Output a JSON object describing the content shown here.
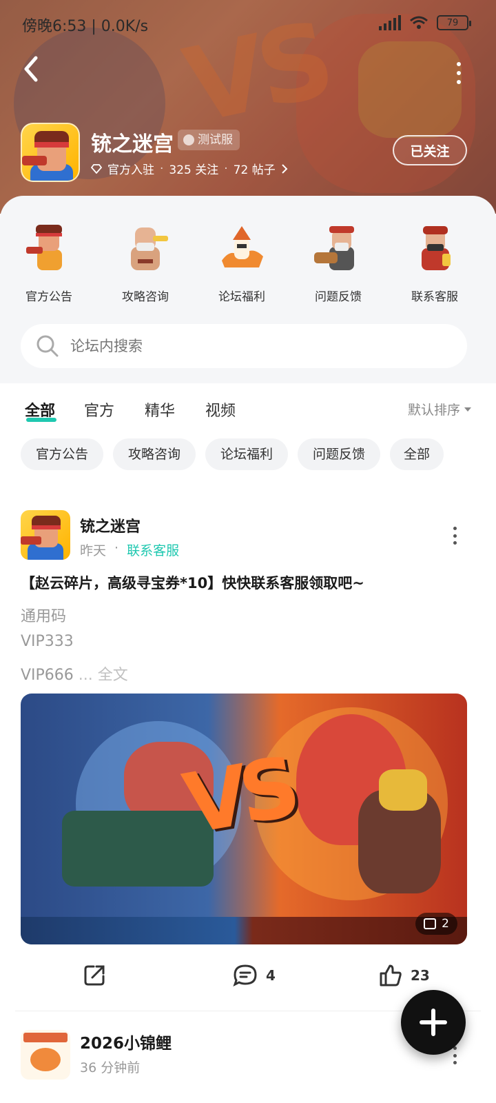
{
  "status_bar": {
    "time": "傍晚6:53 | 0.0K/s",
    "battery": "79"
  },
  "header": {
    "game_title": "铳之迷宫",
    "server_badge": "测试服",
    "official": "官方入驻",
    "followers": "325 关注",
    "posts": "72 帖子",
    "follow_button": "已关注"
  },
  "categories": [
    {
      "label": "官方公告",
      "icon": "announcement-character-icon"
    },
    {
      "label": "攻略咨询",
      "icon": "guide-character-icon"
    },
    {
      "label": "论坛福利",
      "icon": "welfare-character-icon"
    },
    {
      "label": "问题反馈",
      "icon": "feedback-character-icon"
    },
    {
      "label": "联系客服",
      "icon": "support-character-icon"
    }
  ],
  "search": {
    "placeholder": "论坛内搜索"
  },
  "tabs": [
    {
      "label": "全部",
      "active": true
    },
    {
      "label": "官方",
      "active": false
    },
    {
      "label": "精华",
      "active": false
    },
    {
      "label": "视频",
      "active": false
    }
  ],
  "sort_label": "默认排序",
  "chips": [
    "官方公告",
    "攻略咨询",
    "论坛福利",
    "问题反馈",
    "全部"
  ],
  "post1": {
    "author": "铳之迷宫",
    "time": "昨天",
    "separator": "·",
    "category_link": "联系客服",
    "title": "【赵云碎片，高级寻宝券*10】快快联系客服领取吧~",
    "lines": [
      "通用码",
      "VIP333",
      "VIP666"
    ],
    "ellipsis": " ... ",
    "read_more": "全文",
    "image_count": "2",
    "comments": "4",
    "likes": "23"
  },
  "post2": {
    "author": "2026小锦鲤",
    "time": "36 分钟前"
  },
  "colors": {
    "accent": "#1fc8b0",
    "header_bg": "#b8624a"
  }
}
